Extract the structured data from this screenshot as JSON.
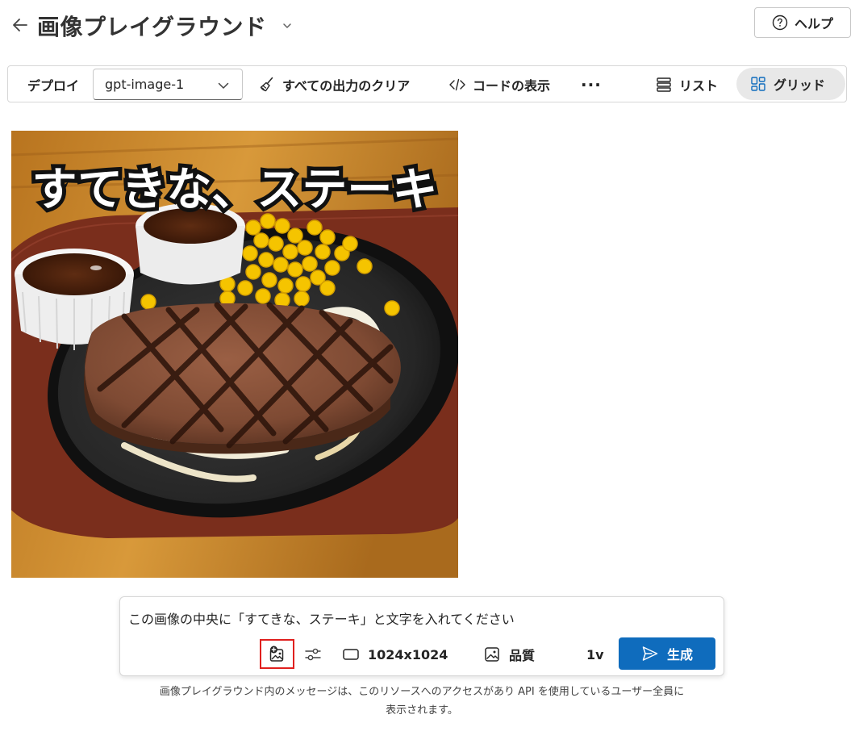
{
  "header": {
    "title": "画像プレイグラウンド",
    "help_label": "ヘルプ"
  },
  "toolbar": {
    "deploy_label": "デプロイ",
    "deployment_value": "gpt-image-1",
    "clear_label": "すべての出力のクリア",
    "code_label": "コードの表示",
    "more_label": "···",
    "list_label": "リスト",
    "grid_label": "グリッド",
    "active_view": "grid"
  },
  "image": {
    "caption_text": "すてきな、ステーキ"
  },
  "composer": {
    "prompt_value": "この画像の中央に「すてきな、ステーキ」と文字を入れてください",
    "size_label": "1024x1024",
    "quality_label": "品質",
    "count_label": "1v",
    "generate_label": "生成"
  },
  "disclaimer": {
    "line1": "画像プレイグラウンド内のメッセージは、このリソースへのアクセスがあり API を使用しているユーザー全員に",
    "line2": "表示されます。"
  },
  "colors": {
    "accent": "#0f6cbd",
    "highlight_box": "#e0201e"
  }
}
